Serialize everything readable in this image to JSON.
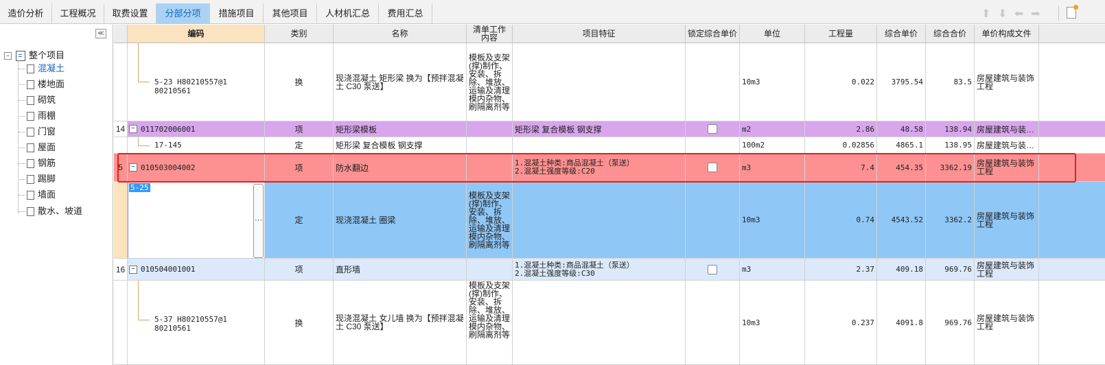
{
  "tabs": [
    {
      "label": "造价分析"
    },
    {
      "label": "工程概况"
    },
    {
      "label": "取费设置"
    },
    {
      "label": "分部分项"
    },
    {
      "label": "措施项目"
    },
    {
      "label": "其他项目"
    },
    {
      "label": "人材机汇总"
    },
    {
      "label": "费用汇总"
    }
  ],
  "active_tab": "分部分项",
  "toolbar_icons": [
    "move-up-icon",
    "move-down-icon",
    "arrow-left-icon",
    "arrow-right-icon",
    "settings-icon"
  ],
  "left_tree": {
    "collapse_glyph": "≪",
    "root": "整个项目",
    "items": [
      "混凝土",
      "楼地面",
      "砌筑",
      "雨棚",
      "门窗",
      "屋面",
      "钢筋",
      "踢脚",
      "墙面",
      "散水、坡道"
    ],
    "selected": "混凝土"
  },
  "grid": {
    "headers": [
      "编码",
      "类别",
      "名称",
      "清单工作内容",
      "项目特征",
      "锁定综合单价",
      "单位",
      "工程量",
      "综合单价",
      "综合合价",
      "单价构成文件"
    ],
    "rows": [
      {
        "num": "",
        "code": "5-23 H80210557@1 80210561",
        "type": "换",
        "name": "现浇混凝土 矩形梁  换为【预拌混凝土 C30 泵送】",
        "work": "模板及支架(撑)制作、安装、拆除、堆放、运输及清理模内杂物、刷隔离剂等",
        "feature": "",
        "unit": "10m3",
        "qty": "0.022",
        "price": "3795.54",
        "total": "83.5",
        "file": "房屋建筑与装饰工程"
      },
      {
        "num": "14",
        "code": "011702006001",
        "type": "项",
        "name": "矩形梁模板",
        "work": "",
        "feature": "矩形梁 复合模板 钢支撑",
        "unit": "m2",
        "qty": "2.86",
        "price": "48.58",
        "total": "138.94",
        "file": "房屋建筑与装…"
      },
      {
        "num": "",
        "code": "17-145",
        "type": "定",
        "name": "矩形梁 复合模板 钢支撑",
        "work": "",
        "feature": "",
        "unit": "100m2",
        "qty": "0.02856",
        "price": "4865.1",
        "total": "138.95",
        "file": "房屋建筑与装…"
      },
      {
        "num": "5",
        "code": "010503004002",
        "type": "项",
        "name": "防水翻边",
        "work": "",
        "feature": "1.混凝土种类:商品混凝土（泵送）\n2.混凝土强度等级:C20",
        "unit": "m3",
        "qty": "7.4",
        "price": "454.35",
        "total": "3362.19",
        "file": "房屋建筑与装饰工程"
      },
      {
        "num": "",
        "code": "5-25",
        "type": "定",
        "name": "现浇混凝土 圈梁",
        "work": "模板及支架(撑)制作、安装、拆除、堆放、运输及清理模内杂物、刷隔离剂等",
        "feature": "",
        "unit": "10m3",
        "qty": "0.74",
        "price": "4543.52",
        "total": "3362.2",
        "file": "房屋建筑与装饰工程"
      },
      {
        "num": "16",
        "code": "010504001001",
        "type": "项",
        "name": "直形墙",
        "work": "",
        "feature": "1.混凝土种类:商品混凝土（泵送）\n2.混凝土强度等级:C30",
        "unit": "m3",
        "qty": "2.37",
        "price": "409.18",
        "total": "969.76",
        "file": "房屋建筑与装饰工程"
      },
      {
        "num": "",
        "code": "5-37 H80210557@1 80210561",
        "type": "换",
        "name": "现浇混凝土 女儿墙  换为【预拌混凝土 C30 泵送】",
        "work": "模板及支架(撑)制作、安装、拆除、堆放、运输及清理模内杂物、刷隔离剂等",
        "feature": "",
        "unit": "10m3",
        "qty": "0.237",
        "price": "4091.8",
        "total": "969.76",
        "file": "房屋建筑与装饰工程"
      }
    ]
  },
  "colors": {
    "measure_row": "#d8a6ec",
    "highlight_row": "#fd9191",
    "selected_row": "#8fc7f6",
    "item_row": "#dbe9fb",
    "highlight_border": "#e02020",
    "active_tab_bg": "#a9d2f3",
    "active_header_bg": "#fbe3bf"
  }
}
